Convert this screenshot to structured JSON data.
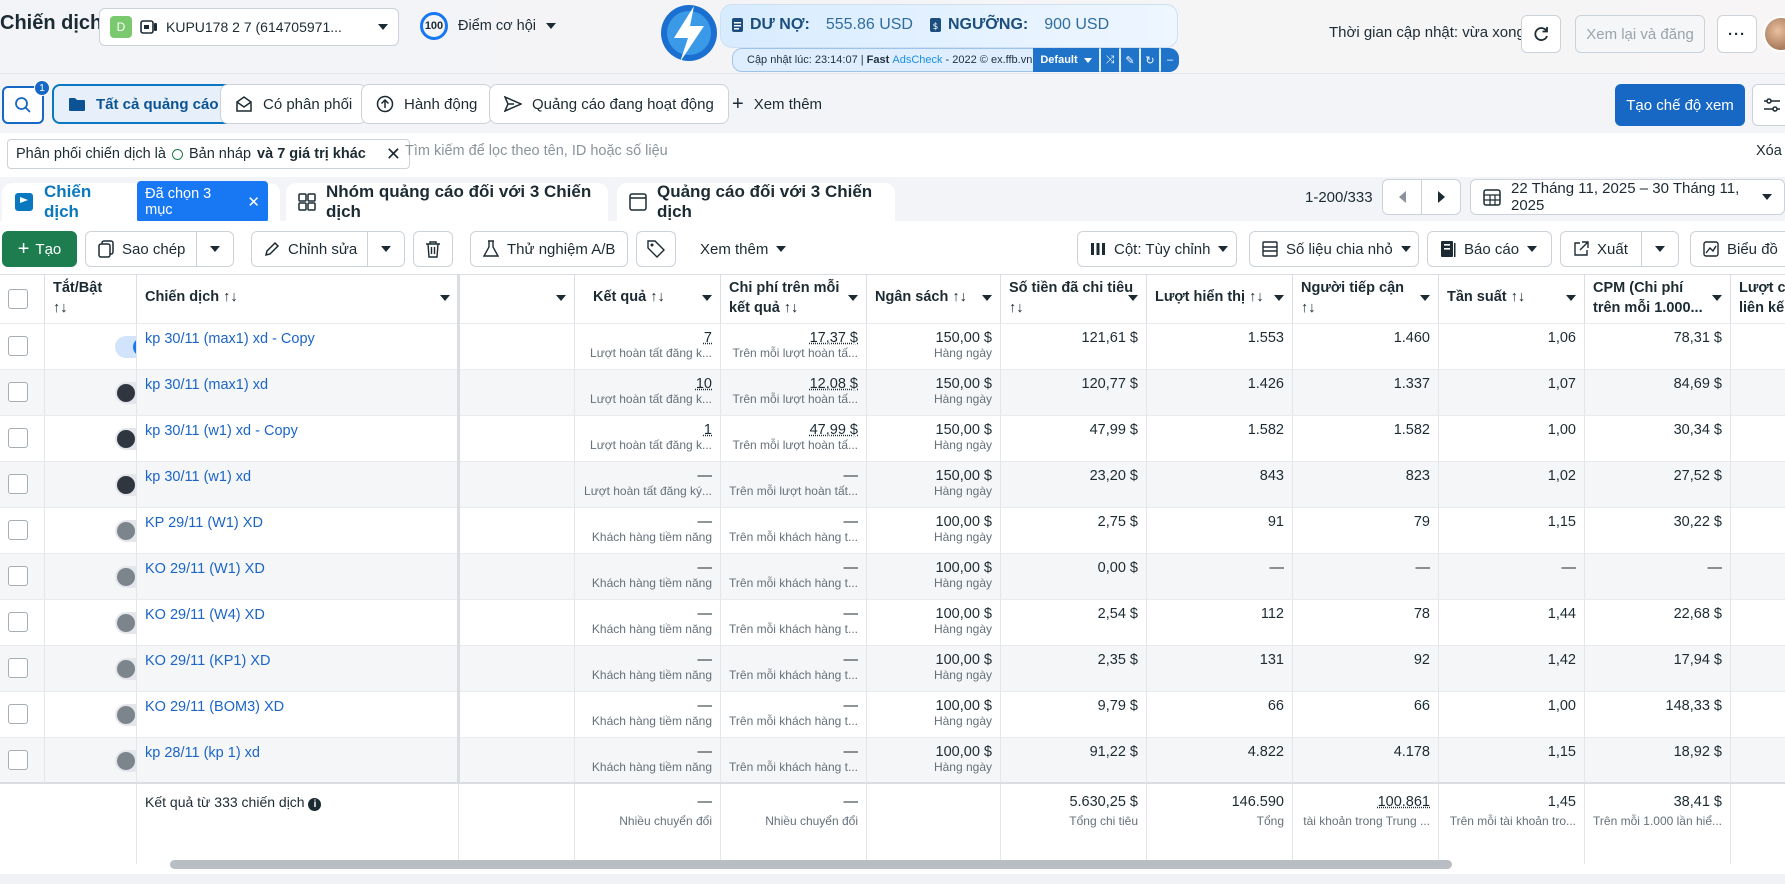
{
  "header": {
    "title": "Chiến dịch",
    "account_initial": "D",
    "account_name": "KUPU178 2 7 (614705971...",
    "opportunity_score": "100",
    "opportunity_label": "Điểm cơ hội",
    "update_time": "Thời gian cập nhật: vừa xong",
    "review_label": "Xem lại và đăng"
  },
  "adscheck": {
    "debt_label": "DƯ NỢ:",
    "debt_value": "555.86 USD",
    "threshold_label": "NGƯỠNG:",
    "threshold_value": "900 USD",
    "footer_prefix": "Cập nhật lúc: 23:14:07 | ",
    "footer_brand1": "Fast ",
    "footer_brand2": "AdsCheck",
    "footer_suffix": " - 2022 © ex.ffb.vn",
    "preset": "Default"
  },
  "filter_tabs": {
    "search_badge": "1",
    "all_ads": "Tất cả quảng cáo",
    "delivering": "Có phân phối",
    "actions": "Hành động",
    "active_ads": "Quảng cáo đang hoạt động",
    "see_more": "Xem thêm",
    "create_view": "Tạo chế độ xem"
  },
  "filterbar": {
    "chip_prefix": "Phân phối chiến dịch là",
    "chip_value": "Bản nháp",
    "chip_suffix": "và 7 giá trị khác",
    "search_placeholder": "Tìm kiếm để lọc theo tên, ID hoặc số liệu",
    "clear": "Xóa"
  },
  "levels": {
    "campaigns": "Chiến dịch",
    "selected": "Đã chọn 3 mục",
    "adsets": "Nhóm quảng cáo đối với 3 Chiến dịch",
    "ads": "Quảng cáo đối với 3 Chiến dịch",
    "pager": "1-200/333",
    "date_range": "22 Tháng 11, 2025 – 30 Tháng 11, 2025"
  },
  "toolbar": {
    "create": "Tạo",
    "duplicate": "Sao chép",
    "edit": "Chỉnh sửa",
    "ab_test": "Thử nghiệm A/B",
    "more": "Xem thêm",
    "columns": "Cột: Tùy chỉnh",
    "breakdown": "Số liệu chia nhỏ",
    "reports": "Báo cáo",
    "export": "Xuất",
    "chart": "Biểu đồ"
  },
  "columns": {
    "toggle": "Tắt/Bật",
    "name": "Chiến dịch",
    "results": "Kết quả",
    "cpr": "Chi phí trên mỗi kết quả",
    "budget": "Ngân sách",
    "spent": "Số tiền đã chi tiêu",
    "impressions": "Lượt hiển thị",
    "reach": "Người tiếp cận",
    "frequency": "Tần suất",
    "cpm": "CPM (Chi phí trên mỗi 1.000...",
    "link": "Lượt c liên kế"
  },
  "rows": [
    {
      "toggle": "on",
      "name": "kp 30/11 (max1) xd - Copy",
      "result": "7",
      "result_sub": "Lượt hoàn tất đăng k...",
      "cpr": "17,37 $",
      "cpr_sub": "Trên mỗi lượt hoàn tấ...",
      "budget": "150,00 $",
      "budget_sub": "Hàng ngày",
      "spent": "121,61 $",
      "impr": "1.553",
      "reach": "1.460",
      "freq": "1,06",
      "cpm": "78,31 $"
    },
    {
      "toggle": "off",
      "name": "kp 30/11 (max1) xd",
      "result": "10",
      "result_sub": "Lượt hoàn tất đăng k...",
      "cpr": "12,08 $",
      "cpr_sub": "Trên mỗi lượt hoàn tấ...",
      "budget": "150,00 $",
      "budget_sub": "Hàng ngày",
      "spent": "120,77 $",
      "impr": "1.426",
      "reach": "1.337",
      "freq": "1,07",
      "cpm": "84,69 $"
    },
    {
      "toggle": "off",
      "name": "kp 30/11 (w1) xd - Copy",
      "result": "1",
      "result_sub": "Lượt hoàn tất đăng k...",
      "cpr": "47,99 $",
      "cpr_sub": "Trên mỗi lượt hoàn tấ...",
      "budget": "150,00 $",
      "budget_sub": "Hàng ngày",
      "spent": "47,99 $",
      "impr": "1.582",
      "reach": "1.582",
      "freq": "1,00",
      "cpm": "30,34 $"
    },
    {
      "toggle": "off",
      "name": "kp 30/11 (w1) xd",
      "result": "—",
      "result_sub": "Lượt hoàn tất đăng ký...",
      "cpr": "—",
      "cpr_sub": "Trên mỗi lượt hoàn tất...",
      "budget": "150,00 $",
      "budget_sub": "Hàng ngày",
      "spent": "23,20 $",
      "impr": "843",
      "reach": "823",
      "freq": "1,02",
      "cpm": "27,52 $"
    },
    {
      "toggle": "dis",
      "name": "KP 29/11 (W1) XD",
      "result": "—",
      "result_sub": "Khách hàng tiềm năng",
      "cpr": "—",
      "cpr_sub": "Trên mỗi khách hàng t...",
      "budget": "100,00 $",
      "budget_sub": "Hàng ngày",
      "spent": "2,75 $",
      "impr": "91",
      "reach": "79",
      "freq": "1,15",
      "cpm": "30,22 $"
    },
    {
      "toggle": "dis",
      "name": "KO 29/11 (W1) XD",
      "result": "—",
      "result_sub": "Khách hàng tiềm năng",
      "cpr": "—",
      "cpr_sub": "Trên mỗi khách hàng t...",
      "budget": "100,00 $",
      "budget_sub": "Hàng ngày",
      "spent": "0,00 $",
      "impr": "—",
      "reach": "—",
      "freq": "—",
      "cpm": "—"
    },
    {
      "toggle": "dis",
      "name": "KO 29/11 (W4) XD",
      "result": "—",
      "result_sub": "Khách hàng tiềm năng",
      "cpr": "—",
      "cpr_sub": "Trên mỗi khách hàng t...",
      "budget": "100,00 $",
      "budget_sub": "Hàng ngày",
      "spent": "2,54 $",
      "impr": "112",
      "reach": "78",
      "freq": "1,44",
      "cpm": "22,68 $"
    },
    {
      "toggle": "dis",
      "name": "KO 29/11 (KP1) XD",
      "result": "—",
      "result_sub": "Khách hàng tiềm năng",
      "cpr": "—",
      "cpr_sub": "Trên mỗi khách hàng t...",
      "budget": "100,00 $",
      "budget_sub": "Hàng ngày",
      "spent": "2,35 $",
      "impr": "131",
      "reach": "92",
      "freq": "1,42",
      "cpm": "17,94 $"
    },
    {
      "toggle": "dis",
      "name": "KO 29/11 (BOM3) XD",
      "result": "—",
      "result_sub": "Khách hàng tiềm năng",
      "cpr": "—",
      "cpr_sub": "Trên mỗi khách hàng t...",
      "budget": "100,00 $",
      "budget_sub": "Hàng ngày",
      "spent": "9,79 $",
      "impr": "66",
      "reach": "66",
      "freq": "1,00",
      "cpm": "148,33 $"
    },
    {
      "toggle": "dis",
      "name": "kp 28/11 (kp 1) xd",
      "result": "—",
      "result_sub": "Khách hàng tiềm năng",
      "cpr": "—",
      "cpr_sub": "Trên mỗi khách hàng t...",
      "budget": "100,00 $",
      "budget_sub": "Hàng ngày",
      "spent": "91,22 $",
      "impr": "4.822",
      "reach": "4.178",
      "freq": "1,15",
      "cpm": "18,92 $"
    }
  ],
  "summary": {
    "label": "Kết quả từ 333 chiến dịch",
    "result": "—",
    "result_sub": "Nhiều chuyển đổi",
    "cpr": "—",
    "cpr_sub": "Nhiều chuyển đổi",
    "spent": "5.630,25 $",
    "spent_sub": "Tổng chi tiêu",
    "impr": "146.590",
    "impr_sub": "Tổng",
    "reach": "100.861",
    "reach_sub": "tài khoản trong Trung ...",
    "freq": "1,45",
    "freq_sub": "Trên mỗi tài khoản tro...",
    "cpm": "38,41 $",
    "cpm_sub": "Trên mỗi 1.000 lần hiể..."
  }
}
